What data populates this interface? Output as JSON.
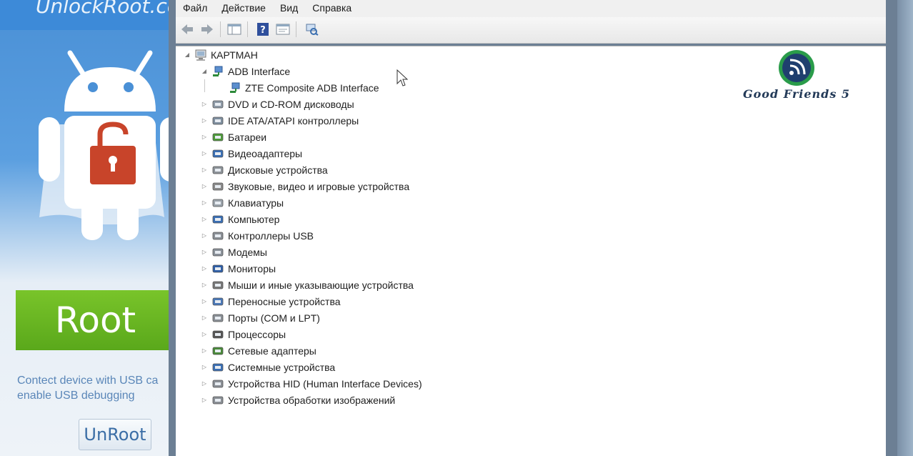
{
  "unlock_app": {
    "title": "UnlockRoot.co",
    "root_label": "Root",
    "hint_line1": "Contect device with USB ca",
    "hint_line2": "enable USB debugging",
    "unroot_label": "UnRoot"
  },
  "window": {
    "menu": [
      "Файл",
      "Действие",
      "Вид",
      "Справка"
    ],
    "toolbar": [
      "back-arrow-icon",
      "forward-arrow-icon",
      "console-tree-icon",
      "help-icon",
      "properties-icon",
      "scan-hardware-icon"
    ]
  },
  "tree": {
    "root": "КАРТМАН",
    "expanded_group": "ADB Interface",
    "expanded_child": "ZTE Composite ADB Interface",
    "categories": [
      "DVD и CD-ROM дисководы",
      "IDE ATA/ATAPI контроллеры",
      "Батареи",
      "Видеоадаптеры",
      "Дисковые устройства",
      "Звуковые, видео и игровые устройства",
      "Клавиатуры",
      "Компьютер",
      "Контроллеры USB",
      "Модемы",
      "Мониторы",
      "Мыши и иные указывающие устройства",
      "Переносные устройства",
      "Порты (COM и LPT)",
      "Процессоры",
      "Сетевые адаптеры",
      "Системные устройства",
      "Устройства HID (Human Interface Devices)",
      "Устройства обработки изображений"
    ]
  },
  "watermark": {
    "text": "Good Friends 5"
  },
  "colors": {
    "root_green": "#6ab823",
    "unlock_blue": "#3d8ad8",
    "padlock_red": "#c8442a"
  }
}
